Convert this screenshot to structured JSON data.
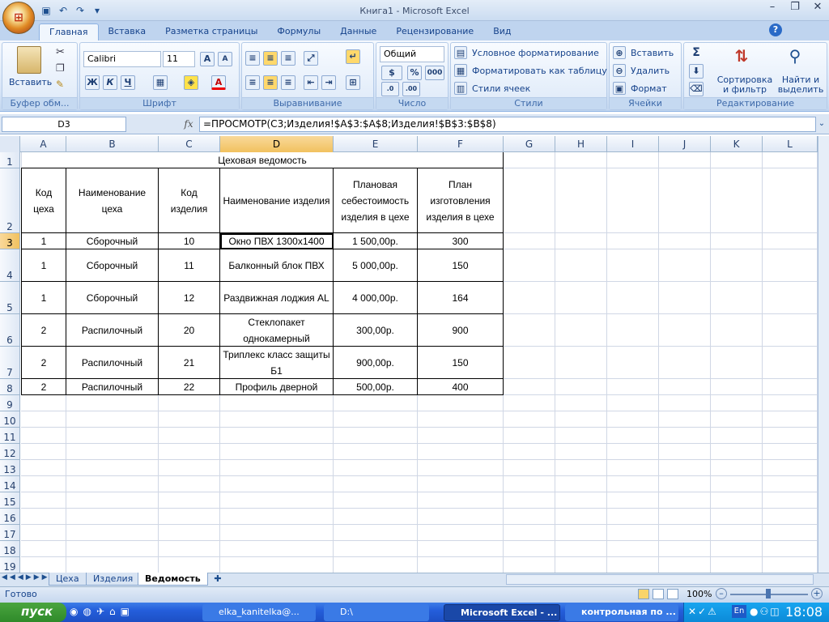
{
  "app": {
    "title": "Книга1 - Microsoft Excel"
  },
  "tabs": [
    "Главная",
    "Вставка",
    "Разметка страницы",
    "Формулы",
    "Данные",
    "Рецензирование",
    "Вид"
  ],
  "ribbon": {
    "clipboard": {
      "paste": "Вставить",
      "label": "Буфер обм..."
    },
    "font": {
      "name": "Calibri",
      "size": "11",
      "bold": "Ж",
      "italic": "К",
      "underline": "Ч",
      "label": "Шрифт"
    },
    "alignment": {
      "label": "Выравнивание"
    },
    "number": {
      "format": "Общий",
      "percent": "%",
      "thousands": "000",
      "label": "Число"
    },
    "styles": {
      "conditional": "Условное форматирование",
      "as_table": "Форматировать как таблицу",
      "cell_styles": "Стили ячеек",
      "label": "Стили"
    },
    "cells": {
      "insert": "Вставить",
      "delete": "Удалить",
      "format": "Формат",
      "label": "Ячейки"
    },
    "editing": {
      "sum": "Σ",
      "sort": "Сортировка и фильтр",
      "find": "Найти и выделить",
      "label": "Редактирование"
    }
  },
  "formula_bar": {
    "name_box": "D3",
    "fx": "fx",
    "formula": "=ПРОСМОТР(C3;Изделия!$A$3:$A$8;Изделия!$B$3:$B$8)"
  },
  "columns": [
    "A",
    "B",
    "C",
    "D",
    "E",
    "F",
    "G",
    "H",
    "I",
    "J",
    "K",
    "L"
  ],
  "rows": [
    "1",
    "2",
    "3",
    "4",
    "5",
    "6",
    "7",
    "8",
    "9",
    "10",
    "11",
    "12",
    "13",
    "14",
    "15",
    "16",
    "17",
    "18",
    "19"
  ],
  "sheet": {
    "title": "Цеховая ведомость",
    "headers": [
      "Код цеха",
      "Наименование цеха",
      "Код изделия",
      "Наименование изделия",
      "Плановая себестоимость изделия в цехе",
      "План изготовления изделия в цехе"
    ],
    "data": [
      [
        "1",
        "Сборочный",
        "10",
        "Окно ПВХ 1300х1400",
        "1 500,00р.",
        "300"
      ],
      [
        "1",
        "Сборочный",
        "11",
        "Балконный блок ПВХ",
        "5 000,00р.",
        "150"
      ],
      [
        "1",
        "Сборочный",
        "12",
        "Раздвижная лоджия AL",
        "4 000,00р.",
        "164"
      ],
      [
        "2",
        "Распилочный",
        "20",
        "Стеклопакет однокамерный",
        "300,00р.",
        "900"
      ],
      [
        "2",
        "Распилочный",
        "21",
        "Триплекс класс защиты Б1",
        "900,00р.",
        "150"
      ],
      [
        "2",
        "Распилочный",
        "22",
        "Профиль дверной",
        "500,00р.",
        "400"
      ]
    ]
  },
  "sheet_tabs": [
    "Цеха",
    "Изделия",
    "Ведомость"
  ],
  "status": {
    "text": "Готово",
    "zoom": "100%"
  },
  "taskbar": {
    "start": "пуск",
    "items": [
      "elka_kanitelka@...",
      "D:\\",
      "Microsoft Excel - ...",
      "контрольная по ..."
    ],
    "lang": "En",
    "clock": "18:08"
  }
}
